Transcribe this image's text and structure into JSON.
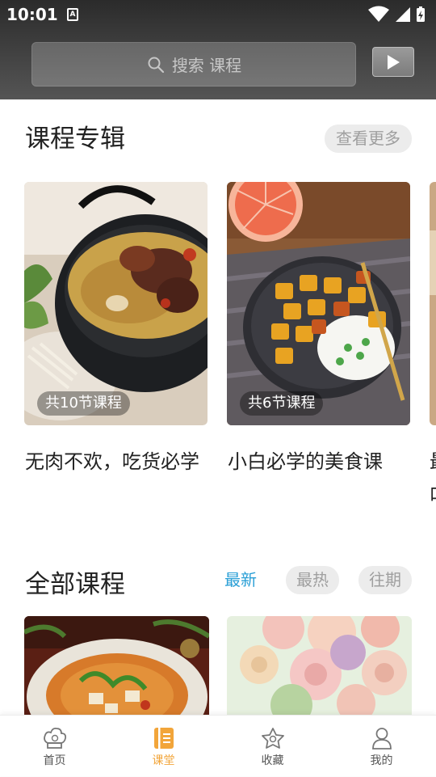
{
  "status_bar": {
    "time": "10:01",
    "notification_badge": "A"
  },
  "search": {
    "placeholder": "搜索 课程"
  },
  "albums_section": {
    "title": "课程专辑",
    "more_label": "查看更多"
  },
  "album_cards": [
    {
      "badge": "共10节课程",
      "title": "无肉不欢，吃货必学"
    },
    {
      "badge": "共6节课程",
      "title": "小白必学的美食课"
    },
    {
      "badge": "",
      "title": "最叫"
    }
  ],
  "all_courses_section": {
    "title": "全部课程",
    "filters": [
      "最新",
      "最热",
      "往期"
    ],
    "active_filter": "最新"
  },
  "tab_bar": {
    "tabs": [
      {
        "label": "首页",
        "icon": "chef-hat-icon"
      },
      {
        "label": "课堂",
        "icon": "book-icon"
      },
      {
        "label": "收藏",
        "icon": "star-icon"
      },
      {
        "label": "我的",
        "icon": "person-icon"
      }
    ],
    "active_tab": "课堂"
  },
  "colors": {
    "accent": "#f2a53a",
    "filter_active": "#2a9fd6",
    "header_dark": "#2b2b2b"
  }
}
